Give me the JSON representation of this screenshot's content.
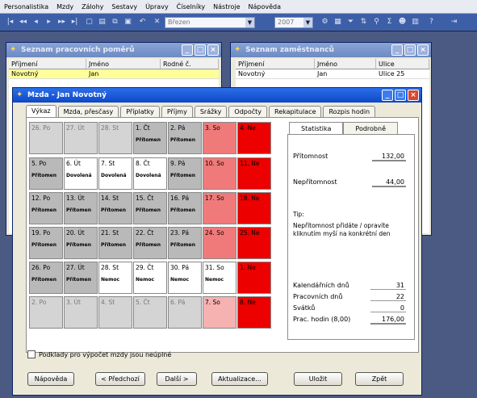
{
  "menu": [
    "Personalistika",
    "Mzdy",
    "Zálohy",
    "Sestavy",
    "Úpravy",
    "Číselníky",
    "Nástroje",
    "Nápověda"
  ],
  "toolbar": {
    "combo_month": "Březen",
    "combo_year": "2007"
  },
  "win_pomeru": {
    "title": "Seznam pracovních poměrů",
    "headers": [
      "Příjmení",
      "Jméno",
      "Rodné č."
    ],
    "rows": [
      [
        "Novotný",
        "Jan",
        ""
      ]
    ]
  },
  "win_zamestnancu": {
    "title": "Seznam zaměstnanců",
    "headers": [
      "Příjmení",
      "Jméno",
      "Ulice"
    ],
    "rows": [
      [
        "Novotný",
        "Jan",
        "Ulice 25"
      ]
    ]
  },
  "mzda": {
    "title": "Mzda - Jan Novotný",
    "tabs": [
      "Výkaz",
      "Mzda, přesčasy",
      "Příplatky",
      "Příjmy",
      "Srážky",
      "Odpočty",
      "Rekapitulace",
      "Rozpis hodin"
    ],
    "calendar": [
      {
        "d": "26. Po",
        "s": "",
        "t": "other"
      },
      {
        "d": "27. Út",
        "s": "",
        "t": "other"
      },
      {
        "d": "28. St",
        "s": "",
        "t": "other"
      },
      {
        "d": "1. Čt",
        "s": "Přítomen",
        "t": "weekday"
      },
      {
        "d": "2. Pá",
        "s": "Přítomen",
        "t": "weekday"
      },
      {
        "d": "3. So",
        "s": "",
        "t": "sat"
      },
      {
        "d": "4. Ne",
        "s": "",
        "t": "sun"
      },
      {
        "d": "5. Po",
        "s": "Přítomen",
        "t": "weekday"
      },
      {
        "d": "6. Út",
        "s": "Dovolená",
        "t": "dov"
      },
      {
        "d": "7. St",
        "s": "Dovolená",
        "t": "dov"
      },
      {
        "d": "8. Čt",
        "s": "Dovolená",
        "t": "dov"
      },
      {
        "d": "9. Pá",
        "s": "Přítomen",
        "t": "weekday"
      },
      {
        "d": "10. So",
        "s": "",
        "t": "sat"
      },
      {
        "d": "11. Ne",
        "s": "",
        "t": "sun"
      },
      {
        "d": "12. Po",
        "s": "Přítomen",
        "t": "weekday"
      },
      {
        "d": "13. Út",
        "s": "Přítomen",
        "t": "weekday"
      },
      {
        "d": "14. St",
        "s": "Přítomen",
        "t": "weekday"
      },
      {
        "d": "15. Čt",
        "s": "Přítomen",
        "t": "weekday"
      },
      {
        "d": "16. Pá",
        "s": "Přítomen",
        "t": "weekday"
      },
      {
        "d": "17. So",
        "s": "",
        "t": "sat"
      },
      {
        "d": "18. Ne",
        "s": "",
        "t": "sun"
      },
      {
        "d": "19. Po",
        "s": "Přítomen",
        "t": "weekday"
      },
      {
        "d": "20. Út",
        "s": "Přítomen",
        "t": "weekday"
      },
      {
        "d": "21. St",
        "s": "Přítomen",
        "t": "weekday"
      },
      {
        "d": "22. Čt",
        "s": "Přítomen",
        "t": "weekday"
      },
      {
        "d": "23. Pá",
        "s": "Přítomen",
        "t": "weekday"
      },
      {
        "d": "24. So",
        "s": "",
        "t": "sat"
      },
      {
        "d": "25. Ne",
        "s": "",
        "t": "sun"
      },
      {
        "d": "26. Po",
        "s": "Přítomen",
        "t": "weekday"
      },
      {
        "d": "27. Út",
        "s": "Přítomen",
        "t": "weekday"
      },
      {
        "d": "28. St",
        "s": "Nemoc",
        "t": "dov"
      },
      {
        "d": "29. Čt",
        "s": "Nemoc",
        "t": "dov"
      },
      {
        "d": "30. Pá",
        "s": "Nemoc",
        "t": "dov"
      },
      {
        "d": "31. So",
        "s": "Nemoc",
        "t": "satw"
      },
      {
        "d": "1. Ne",
        "s": "",
        "t": "sun"
      },
      {
        "d": "2. Po",
        "s": "",
        "t": "other"
      },
      {
        "d": "3. Út",
        "s": "",
        "t": "other"
      },
      {
        "d": "4. St",
        "s": "",
        "t": "other"
      },
      {
        "d": "5. Čt",
        "s": "",
        "t": "other"
      },
      {
        "d": "6. Pá",
        "s": "",
        "t": "other"
      },
      {
        "d": "7. So",
        "s": "",
        "t": "satother"
      },
      {
        "d": "8. Ne",
        "s": "",
        "t": "sun"
      }
    ],
    "stat_tabs": [
      "Statistika",
      "Podrobně"
    ],
    "pritomnost_label": "Přítomnost",
    "pritomnost_value": "132,00",
    "nepritomnost_label": "Nepřítomnost",
    "nepritomnost_value": "44,00",
    "tip_title": "Tip:",
    "tip_text": "Nepřítomnost přidáte / opravíte kliknutím myší na konkrétní den",
    "kal_dnu_label": "Kalendářních dnů",
    "kal_dnu_value": "31",
    "prac_dnu_label": "Pracovních dnů",
    "prac_dnu_value": "22",
    "svatku_label": "Svátků",
    "svatku_value": "0",
    "prac_hodin_label": "Prac. hodin (8,00)",
    "prac_hodin_value": "176,00",
    "checkbox_label": "Podklady pro výpočet mzdy jsou neúplné",
    "buttons": {
      "help": "Nápověda",
      "prev": "< Předchozí",
      "next": "Další >",
      "update": "Aktualizace...",
      "save": "Uložit",
      "back": "Zpět"
    }
  }
}
